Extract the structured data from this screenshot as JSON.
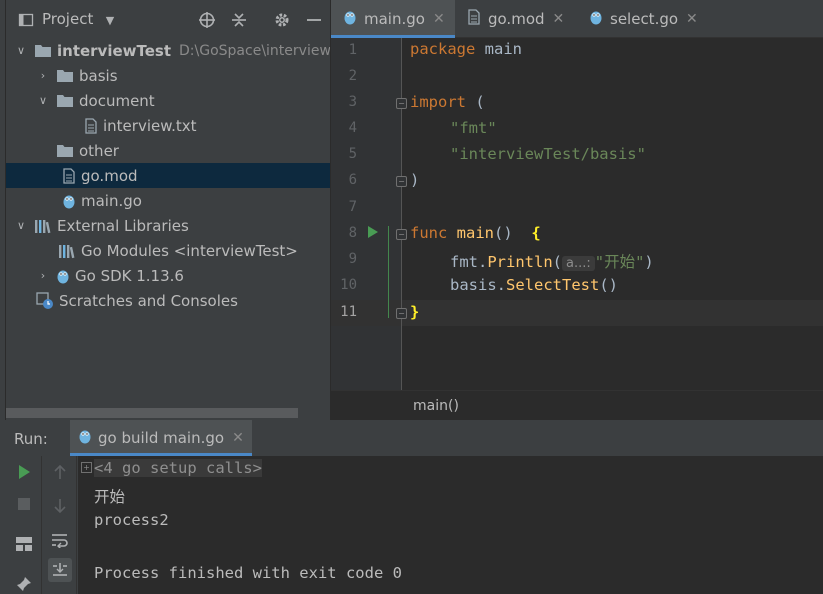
{
  "project_panel": {
    "title": "Project",
    "tree": [
      {
        "label": "interviewTest",
        "path": "D:\\GoSpace\\interviewT"
      },
      {
        "label": "basis"
      },
      {
        "label": "document"
      },
      {
        "label": "interview.txt"
      },
      {
        "label": "other"
      },
      {
        "label": "go.mod"
      },
      {
        "label": "main.go"
      },
      {
        "label": "External Libraries"
      },
      {
        "label": "Go Modules <interviewTest>"
      },
      {
        "label": "Go SDK 1.13.6"
      },
      {
        "label": "Scratches and Consoles"
      }
    ]
  },
  "editor": {
    "tabs": [
      {
        "label": "main.go",
        "active": true
      },
      {
        "label": "go.mod"
      },
      {
        "label": "select.go"
      }
    ],
    "line_numbers": [
      "1",
      "2",
      "3",
      "4",
      "5",
      "6",
      "7",
      "8",
      "9",
      "10",
      "11"
    ],
    "current_line": "11",
    "code": {
      "l1_kw": "package",
      "l1_rest": " main",
      "l3_kw": "import",
      "l3_rest": " (",
      "l4": "\"fmt\"",
      "l5": "\"interviewTest/basis\"",
      "l6": ")",
      "l8_kw": "func",
      "l8_fn": "main",
      "l8_rest": "()  ",
      "l8_brace": "{",
      "l9_pre": "fmt.",
      "l9_fn": "Println",
      "l9_open": "(",
      "l9_hint": "a...:",
      "l9_str": "\"开始\"",
      "l9_close": ")",
      "l10_pre": "basis.",
      "l10_fn": "SelectTest",
      "l10_rest": "()",
      "l11_brace": "}"
    },
    "breadcrumb": "main()"
  },
  "run_panel": {
    "label": "Run:",
    "tab_label": "go build main.go",
    "console_lines": {
      "setup": "<4 go setup calls>",
      "line2": "开始",
      "line3": "process2",
      "line5": "Process finished with exit code 0"
    }
  },
  "colors": {
    "keyword": "#cc7832",
    "string": "#6a8759",
    "function": "#ffc66d",
    "selection": "#0d293e",
    "accent": "#4a88c7",
    "run_green": "#499c54"
  }
}
